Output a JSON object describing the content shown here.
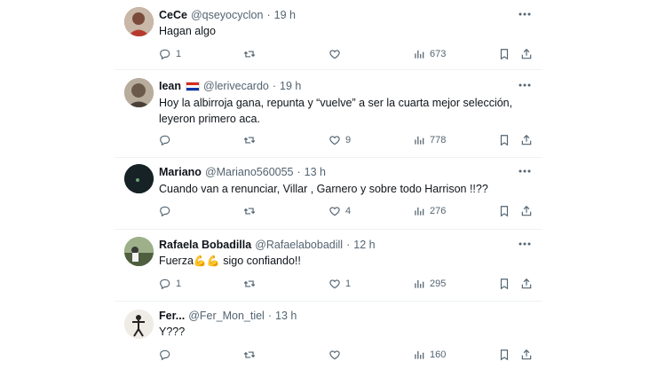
{
  "tweets": [
    {
      "name": "CeCe",
      "handle": "@qseyocyclon",
      "sep": "·",
      "time": "19 h",
      "text": "Hagan algo",
      "replies": "1",
      "retweets": "",
      "likes": "",
      "views": "673",
      "avatar": "#a55a4a"
    },
    {
      "name": "Iean",
      "handle": "@lerivecardo",
      "sep": "·",
      "time": "19 h",
      "text": "Hoy la albirroja gana, repunta y “vuelve” a ser la cuarta mejor selección, leyeron primero aca.",
      "replies": "",
      "retweets": "",
      "likes": "9",
      "views": "778",
      "avatar": "#8f8478",
      "flag": "paraguay-flag"
    },
    {
      "name": "Mariano",
      "handle": "@Mariano560055",
      "sep": "·",
      "time": "13 h",
      "text": "Cuando van a renunciar, Villar , Garnero y sobre todo Harrison !!??",
      "replies": "",
      "retweets": "",
      "likes": "4",
      "views": "276",
      "avatar": "#1c2a2e"
    },
    {
      "name": "Rafaela Bobadilla",
      "handle": "@Rafaelabobadill",
      "sep": "·",
      "time": "12 h",
      "text": "sigo confiando!!",
      "text_pre": "Fuerza",
      "emojis": "💪💪",
      "replies": "1",
      "retweets": "",
      "likes": "1",
      "views": "295",
      "avatar": "#6b7b5c"
    },
    {
      "name": "Fer...",
      "handle": "@Fer_Mon_tiel",
      "sep": "·",
      "time": "13 h",
      "text": "Y???",
      "replies": "",
      "retweets": "",
      "likes": "",
      "views": "160",
      "avatar": "#e8e4dc"
    }
  ],
  "colors": {
    "text": "#0f1419",
    "muted": "#536471",
    "separator": "#eff3f4"
  }
}
